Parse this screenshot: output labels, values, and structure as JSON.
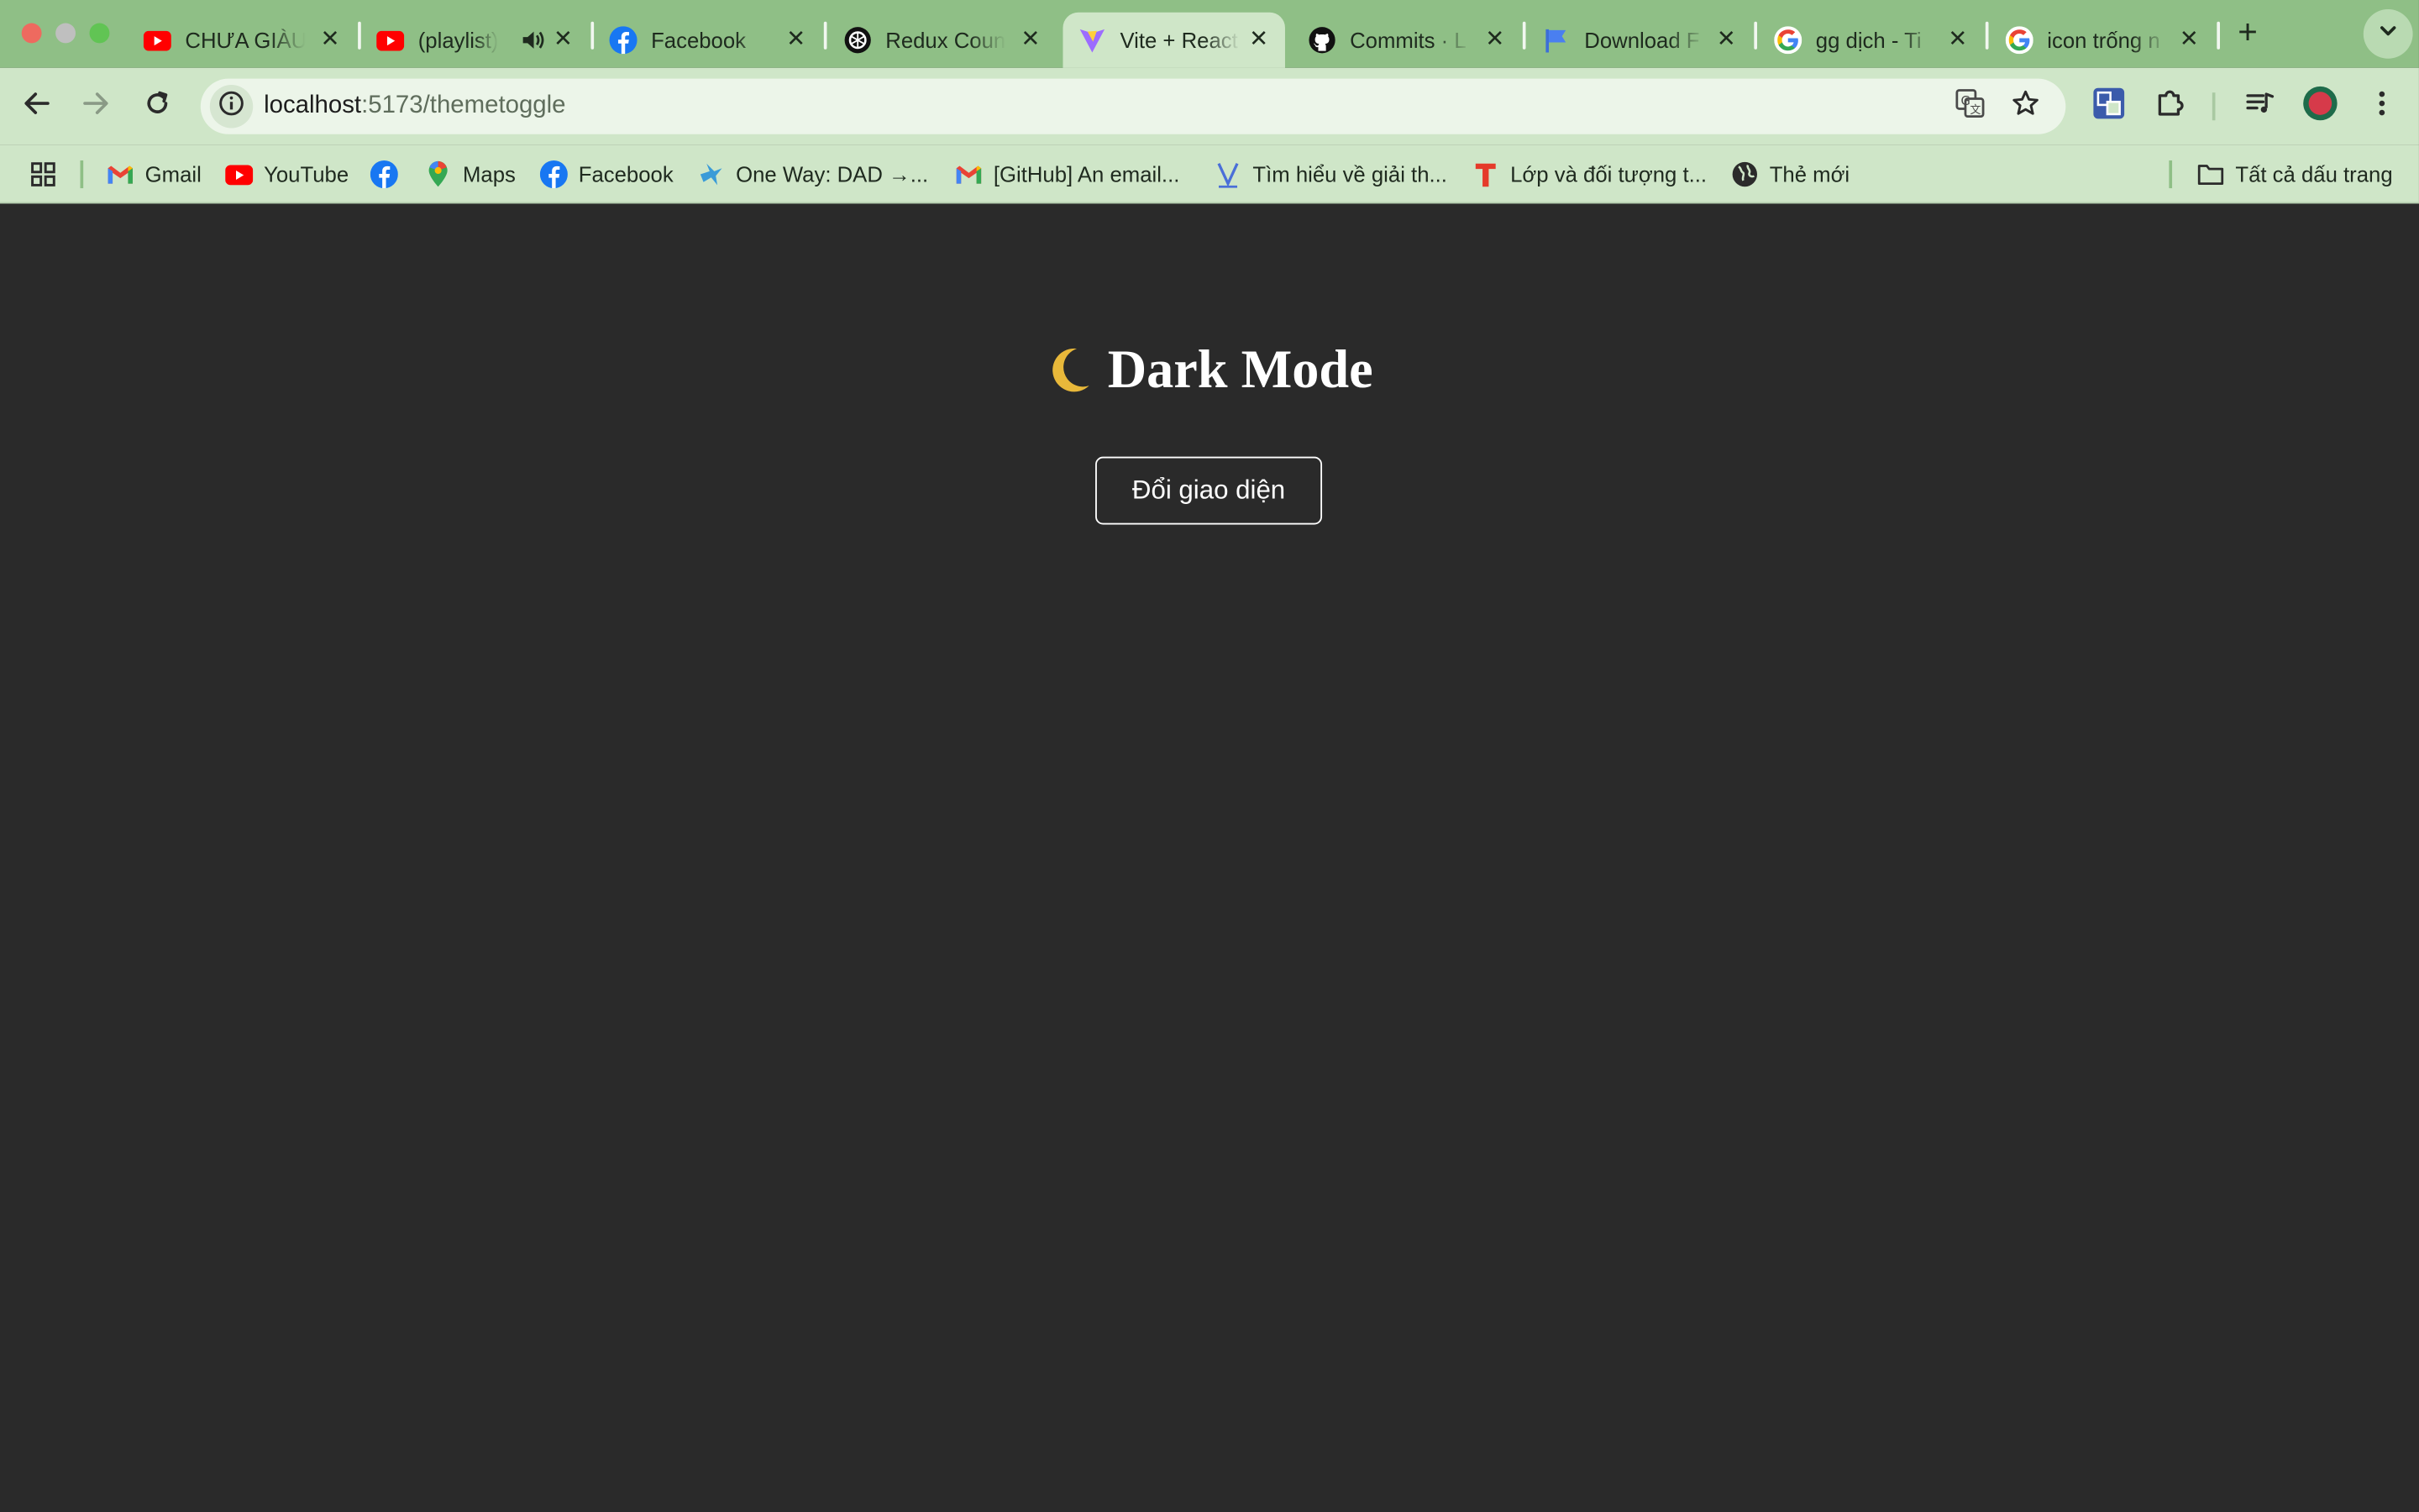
{
  "browser": {
    "tabs": [
      {
        "title": "CHƯA GIÀU",
        "icon": "youtube-icon"
      },
      {
        "title": "(playlist)",
        "icon": "youtube-icon"
      },
      {
        "title": "Facebook",
        "icon": "facebook-icon"
      },
      {
        "title": "Redux Coun",
        "icon": "openai-icon"
      },
      {
        "title": "Vite + React",
        "icon": "vite-icon",
        "active": true
      },
      {
        "title": "Commits · L",
        "icon": "github-icon"
      },
      {
        "title": "Download F",
        "icon": "flag-icon"
      },
      {
        "title": "gg dịch - Ti",
        "icon": "google-icon"
      },
      {
        "title": "icon trống n",
        "icon": "google-icon"
      }
    ],
    "new_tab_label": "+",
    "address": {
      "host": "localhost",
      "path": ":5173/themetoggle"
    },
    "bookmarks": [
      {
        "label": "Gmail",
        "icon": "gmail-icon"
      },
      {
        "label": "YouTube",
        "icon": "youtube-icon"
      },
      {
        "label": "",
        "icon": "facebook-icon"
      },
      {
        "label": "Maps",
        "icon": "maps-icon"
      },
      {
        "label": "Facebook",
        "icon": "facebook-icon"
      },
      {
        "label": "One Way: DAD →...",
        "icon": "bird-icon"
      },
      {
        "label": "[GitHub] An email...",
        "icon": "gmail-icon"
      },
      {
        "label": "Tìm hiểu về giải th...",
        "icon": "v-icon"
      },
      {
        "label": "Lớp và đối tượng t...",
        "icon": "t-icon"
      },
      {
        "label": "Thẻ mới",
        "icon": "globe-icon"
      }
    ],
    "all_bookmarks_label": "Tất cả dấu trang"
  },
  "colors": {
    "page_bg": "#2a2a2a",
    "moon": "#e8b83a",
    "frame": "#8fbf86",
    "toolbar": "#cfe6c8"
  },
  "page": {
    "heading": "Dark Mode",
    "heading_icon": "moon-icon",
    "toggle_button": "Đổi giao diện"
  }
}
